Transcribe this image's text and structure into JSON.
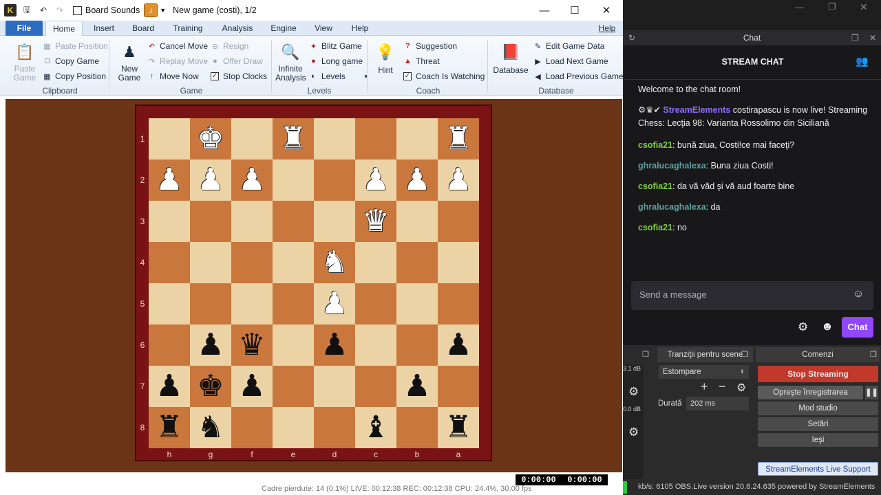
{
  "window": {
    "title": "New game  (costi), 1/2",
    "board_sounds_label": "Board Sounds",
    "minimize": "—",
    "maximize": "☐",
    "close": "✕"
  },
  "ribbon": {
    "tabs": [
      "File",
      "Home",
      "Insert",
      "Board",
      "Training",
      "Analysis",
      "Engine",
      "View",
      "Help"
    ],
    "help_right": "Help",
    "clipboard": {
      "paste_game": [
        "Paste",
        "Game"
      ],
      "paste_position": "Paste Position",
      "copy_game": "Copy Game",
      "copy_position": "Copy Position",
      "group": "Clipboard"
    },
    "game": {
      "new_game": [
        "New",
        "Game"
      ],
      "cancel_move": "Cancel Move",
      "replay_move": "Replay Move",
      "move_now": "Move Now",
      "resign": "Resign",
      "offer_draw": "Offer Draw",
      "stop_clocks": "Stop Clocks",
      "group": "Game"
    },
    "levels": {
      "infinite_analysis": [
        "Infinite",
        "Analysis"
      ],
      "blitz_game": "Blitz Game",
      "long_game": "Long game",
      "levels": "Levels",
      "group": "Levels"
    },
    "coach": {
      "hint": "Hint",
      "suggestion": "Suggestion",
      "threat": "Threat",
      "coach_watching": "Coach Is Watching",
      "group": "Coach"
    },
    "database": {
      "database": "Database",
      "edit_game_data": "Edit Game Data",
      "load_next_game": "Load Next Game",
      "load_previous_game": "Load Previous Game",
      "group": "Database"
    }
  },
  "board": {
    "ranks": [
      "1",
      "2",
      "3",
      "4",
      "5",
      "6",
      "7",
      "8"
    ],
    "files": [
      "h",
      "g",
      "f",
      "e",
      "d",
      "c",
      "b",
      "a"
    ],
    "rows": [
      [
        "",
        "wK",
        "",
        "wR",
        "",
        "",
        "",
        "wR"
      ],
      [
        "wP",
        "wP",
        "wP",
        "",
        "",
        "wP",
        "wP",
        "wP"
      ],
      [
        "",
        "",
        "",
        "",
        "",
        "wQ",
        "",
        ""
      ],
      [
        "",
        "",
        "",
        "",
        "wN",
        "",
        "",
        ""
      ],
      [
        "",
        "",
        "",
        "",
        "wP",
        "",
        "",
        ""
      ],
      [
        "",
        "bP",
        "bQ",
        "",
        "bP",
        "",
        "",
        "bP"
      ],
      [
        "bP",
        "bK",
        "bP",
        "",
        "",
        "",
        "bP",
        ""
      ],
      [
        "bR",
        "bN",
        "",
        "",
        "",
        "bB",
        "",
        "bR"
      ]
    ]
  },
  "clocks": {
    "white": "0:00:00",
    "black": "0:00:00"
  },
  "under_status": "Cadre pierdute: 14 (0.1%)      LIVE: 00:12:38      REC: 00:12:38      CPU: 24.4%, 30.00 fps",
  "obs": {
    "chat_dock_title": "Chat",
    "stream_chat_title": "STREAM CHAT",
    "welcome": "Welcome to the chat room!",
    "messages": [
      {
        "user": "StreamElements",
        "color": "#8f6cff",
        "text": " costirapascu is now live! Streaming Chess: Lecţia 98: Varianta Rossolimo din Siciliană"
      },
      {
        "user": "csofia21",
        "color": "#7fd13b",
        "text": ": bună ziua, Costi!ce mai faceţi?"
      },
      {
        "user": "ghralucaghalexa",
        "color": "#5f9ea0",
        "text": ": Buna ziua Costi!"
      },
      {
        "user": "csofia21",
        "color": "#7fd13b",
        "text": ": da vă văd şi vă aud foarte bine"
      },
      {
        "user": "ghralucaghalexa",
        "color": "#5f9ea0",
        "text": ": da"
      },
      {
        "user": "csofia21",
        "color": "#7fd13b",
        "text": ": no"
      }
    ],
    "send_placeholder": "Send a message",
    "chat_button": "Chat",
    "transitions_title": "Tranziţii pentru scene",
    "controls_title": "Comenzi",
    "transition": "Estompare",
    "duration_label": "Durată",
    "duration_value": "202 ms",
    "db_top": "3.1 dB",
    "db_bottom": "0.0 dB",
    "buttons": [
      "Stop Streaming",
      "Opreşte înregistrarea",
      "Mod studio",
      "Setări",
      "Ieşi"
    ],
    "support": "StreamElements Live Support",
    "status": "kb/s: 6105    OBS.Live version 20.6.24.635 powered by StreamElements"
  },
  "colors": {
    "twitch_purple": "#9147ff",
    "stop_stream": "#c0392b"
  }
}
